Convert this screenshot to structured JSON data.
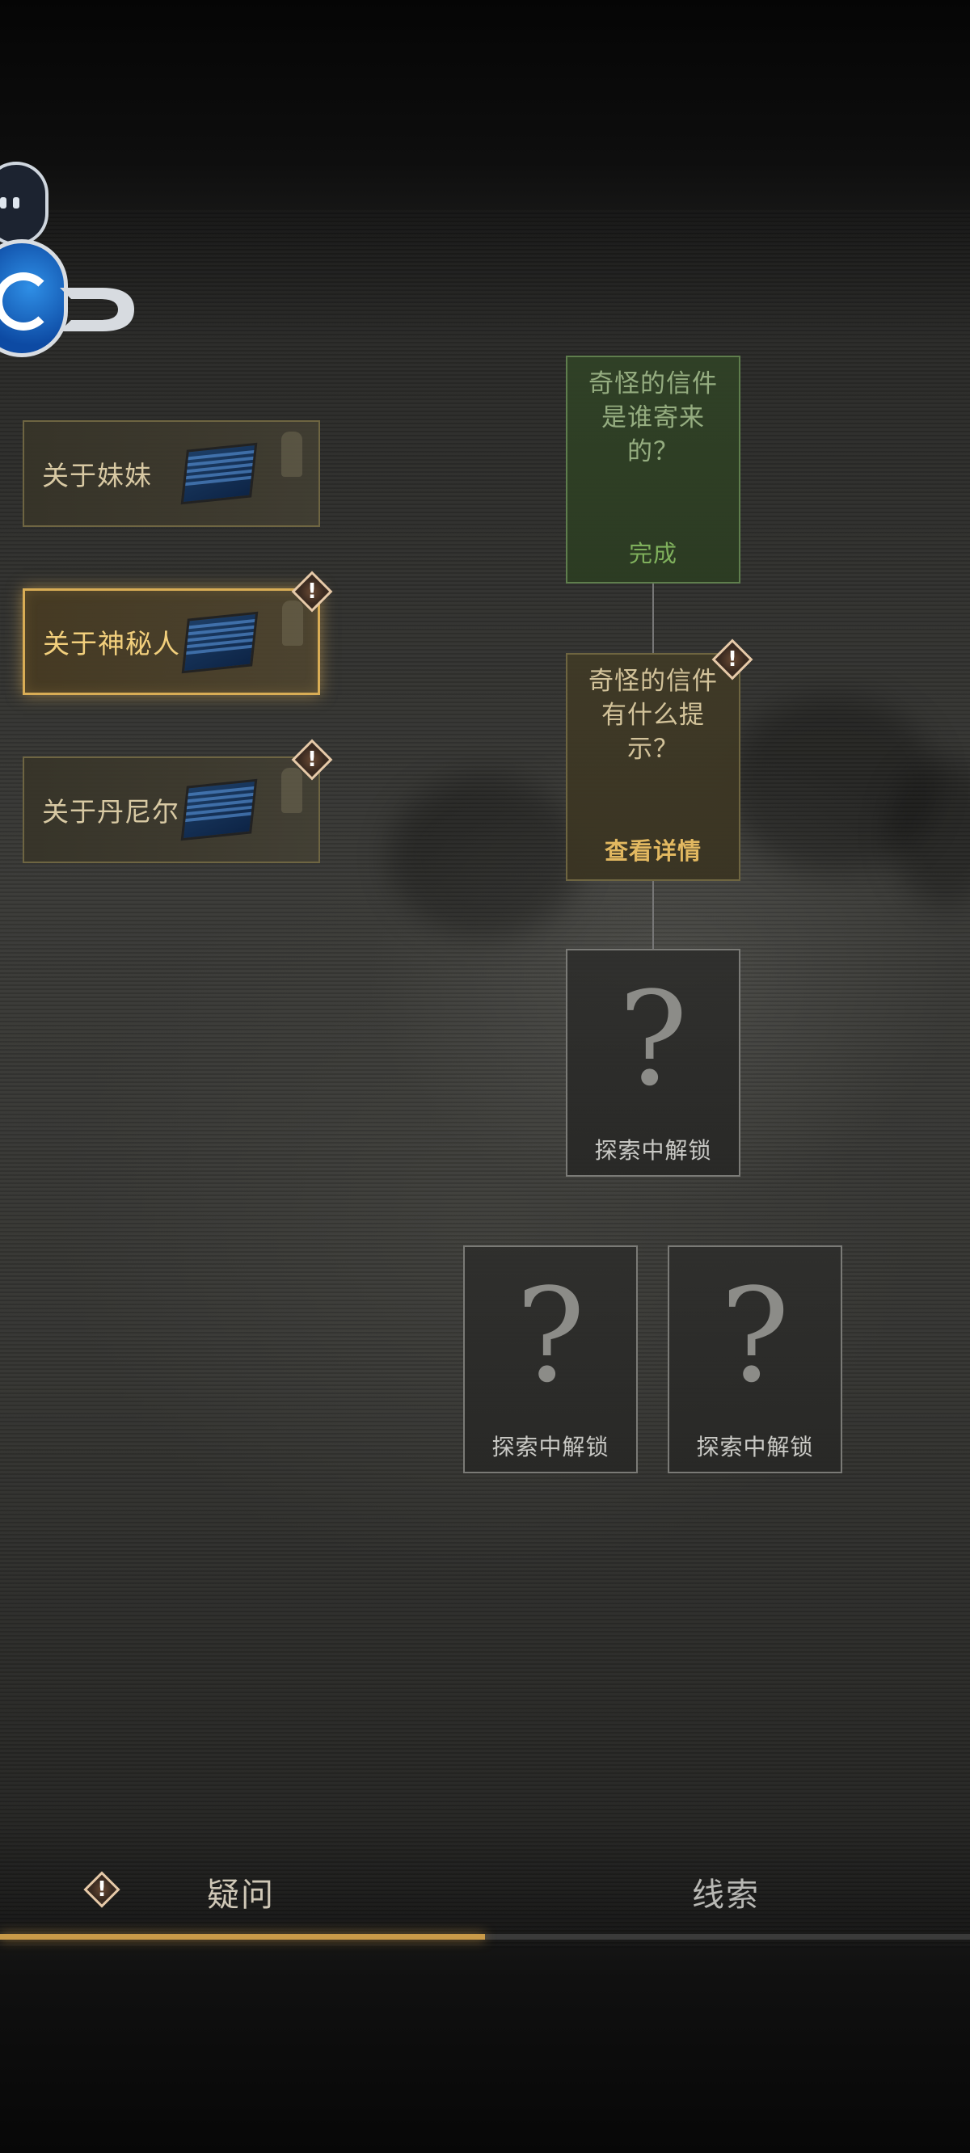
{
  "categories": [
    {
      "label": "关于妹妹",
      "active": false,
      "alert": false
    },
    {
      "label": "关于神秘人",
      "active": true,
      "alert": true
    },
    {
      "label": "关于丹尼尔",
      "active": false,
      "alert": true
    }
  ],
  "questions": [
    {
      "title": "奇怪的信件是谁寄来的？",
      "status": "完成",
      "state": "done"
    },
    {
      "title": "奇怪的信件有什么提示？",
      "status": "查看详情",
      "state": "view",
      "alert": true
    },
    {
      "symbol": "?",
      "status": "探索中解锁",
      "state": "locked"
    },
    {
      "symbol": "?",
      "status": "探索中解锁",
      "state": "locked"
    },
    {
      "symbol": "?",
      "status": "探索中解锁",
      "state": "locked"
    }
  ],
  "tabs": [
    {
      "label": "疑问",
      "active": true,
      "alert": true
    },
    {
      "label": "线索",
      "active": false,
      "alert": false
    }
  ],
  "colors": {
    "accent_gold": "#d9ad55",
    "done_green": "#7fb05c",
    "alert_border": "#e6c9a8"
  },
  "icons": [
    "bubble-icon",
    "logo-icon",
    "laptop-icon",
    "alert-diamond-icon",
    "question-mark-icon"
  ]
}
